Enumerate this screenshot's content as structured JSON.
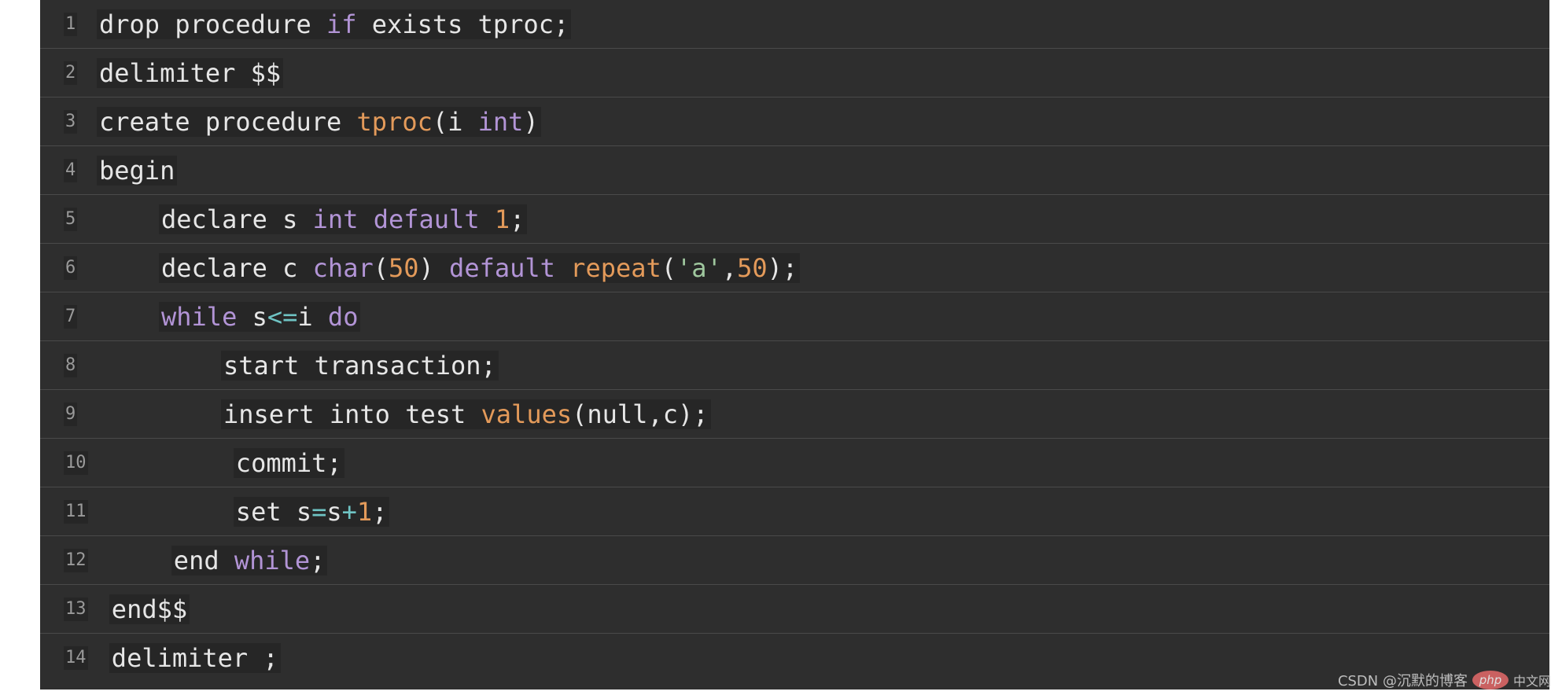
{
  "code": {
    "lines": [
      {
        "number": "1",
        "indent": 0,
        "tokens": [
          {
            "t": "drop procedure ",
            "c": "plain"
          },
          {
            "t": "if",
            "c": "kw"
          },
          {
            "t": " exists tproc;",
            "c": "plain"
          }
        ]
      },
      {
        "number": "2",
        "indent": 0,
        "tokens": [
          {
            "t": "delimiter $$",
            "c": "plain"
          }
        ]
      },
      {
        "number": "3",
        "indent": 0,
        "tokens": [
          {
            "t": "create procedure ",
            "c": "plain"
          },
          {
            "t": "tproc",
            "c": "fn"
          },
          {
            "t": "(i ",
            "c": "plain"
          },
          {
            "t": "int",
            "c": "kw"
          },
          {
            "t": ")",
            "c": "plain"
          }
        ]
      },
      {
        "number": "4",
        "indent": 0,
        "tokens": [
          {
            "t": "begin",
            "c": "plain"
          }
        ]
      },
      {
        "number": "5",
        "indent": 1,
        "tokens": [
          {
            "t": "declare s ",
            "c": "plain"
          },
          {
            "t": "int",
            "c": "kw"
          },
          {
            "t": " ",
            "c": "plain"
          },
          {
            "t": "default",
            "c": "kw"
          },
          {
            "t": " ",
            "c": "plain"
          },
          {
            "t": "1",
            "c": "num"
          },
          {
            "t": ";",
            "c": "plain"
          }
        ]
      },
      {
        "number": "6",
        "indent": 1,
        "tokens": [
          {
            "t": "declare c ",
            "c": "plain"
          },
          {
            "t": "char",
            "c": "kw"
          },
          {
            "t": "(",
            "c": "plain"
          },
          {
            "t": "50",
            "c": "num"
          },
          {
            "t": ") ",
            "c": "plain"
          },
          {
            "t": "default",
            "c": "kw"
          },
          {
            "t": " ",
            "c": "plain"
          },
          {
            "t": "repeat",
            "c": "fn"
          },
          {
            "t": "(",
            "c": "plain"
          },
          {
            "t": "'a'",
            "c": "str"
          },
          {
            "t": ",",
            "c": "plain"
          },
          {
            "t": "50",
            "c": "num"
          },
          {
            "t": ");",
            "c": "plain"
          }
        ]
      },
      {
        "number": "7",
        "indent": 1,
        "tokens": [
          {
            "t": "while",
            "c": "kw"
          },
          {
            "t": " s",
            "c": "plain"
          },
          {
            "t": "<=",
            "c": "op"
          },
          {
            "t": "i ",
            "c": "plain"
          },
          {
            "t": "do",
            "c": "kw"
          }
        ]
      },
      {
        "number": "8",
        "indent": 2,
        "tokens": [
          {
            "t": "start transaction;",
            "c": "plain"
          }
        ]
      },
      {
        "number": "9",
        "indent": 2,
        "tokens": [
          {
            "t": "insert into test ",
            "c": "plain"
          },
          {
            "t": "values",
            "c": "fn"
          },
          {
            "t": "(null,c);",
            "c": "plain"
          }
        ]
      },
      {
        "number": "10",
        "indent": 2.2,
        "tokens": [
          {
            "t": "commit;",
            "c": "plain"
          }
        ]
      },
      {
        "number": "11",
        "indent": 2.2,
        "tokens": [
          {
            "t": "set s",
            "c": "plain"
          },
          {
            "t": "=",
            "c": "op"
          },
          {
            "t": "s",
            "c": "plain"
          },
          {
            "t": "+",
            "c": "op"
          },
          {
            "t": "1",
            "c": "num"
          },
          {
            "t": ";",
            "c": "plain"
          }
        ]
      },
      {
        "number": "12",
        "indent": 1.2,
        "tokens": [
          {
            "t": "end ",
            "c": "plain"
          },
          {
            "t": "while",
            "c": "kw"
          },
          {
            "t": ";",
            "c": "plain"
          }
        ]
      },
      {
        "number": "13",
        "indent": 0.2,
        "tokens": [
          {
            "t": "end$$",
            "c": "plain"
          }
        ]
      },
      {
        "number": "14",
        "indent": 0.2,
        "tokens": [
          {
            "t": "delimiter ;",
            "c": "plain"
          }
        ]
      }
    ]
  },
  "watermark": {
    "text": "CSDN @沉默的博客",
    "logo_text": "php",
    "site_text": "中文网"
  }
}
